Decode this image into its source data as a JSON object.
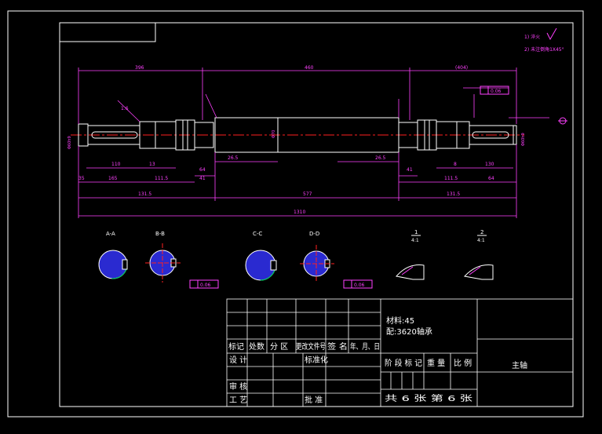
{
  "drawing": {
    "part_name": "主轴",
    "notes": [
      "1) 淬火",
      "2) 未注倒角1X45°"
    ],
    "colors": {
      "background": "#000000",
      "outline": "#ffffff",
      "dimension": "#ff40ff",
      "centerline": "#ff2020",
      "hatch": "#3030ff",
      "keyway": "#00c060"
    },
    "dimensions": {
      "top_left": "396",
      "top_mid": "460",
      "top_right": "(404)",
      "dia_left": "Φ60h9",
      "dia_mid": "Φ70",
      "dia_right": "Φ60h9",
      "length_overall": "1310",
      "length_mid": "577",
      "left_a": "165",
      "left_b": "131.5",
      "left_c": "111.5",
      "left_d": "41",
      "right_a": "64",
      "right_b": "111.5",
      "right_c": "131.5",
      "small_1": "110",
      "small_2": "13",
      "small_3": "26.5",
      "small_4": "26.5",
      "small_5": "8",
      "small_6": "130",
      "small_7": "64",
      "small_8": "41",
      "small_9": "35",
      "tol_1": "0.06",
      "tol_2": "0.06",
      "tol_3": "0.06",
      "rough": "1.6"
    },
    "sections": [
      {
        "label": "A-A"
      },
      {
        "label": "B-B"
      },
      {
        "label": "C-C"
      },
      {
        "label": "D-D"
      },
      {
        "label": "1",
        "scale": "4:1"
      },
      {
        "label": "2",
        "scale": "4:1"
      }
    ],
    "title_block": {
      "material": "材料:45",
      "note2": "配:3620轴承",
      "row_header": [
        "标记",
        "处数",
        "分 区",
        "更改文件号",
        "签 名",
        "年、月、日"
      ],
      "design": "设 计",
      "standard": "标准化",
      "review": "审 核",
      "process": "工 艺",
      "approve": "批 准",
      "stage_mark": "阶 段 标 记",
      "weight": "重 量",
      "scale": "比 例",
      "sheets": "共 6 张  第 6 张"
    }
  }
}
